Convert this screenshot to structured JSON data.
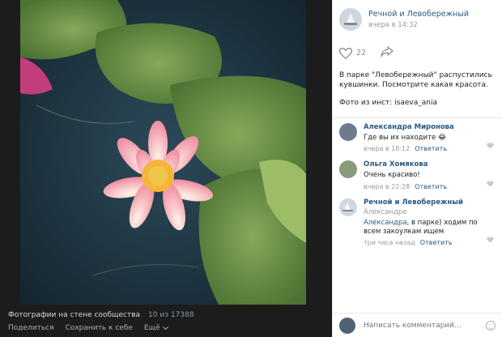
{
  "viewer": {
    "album_title": "Фотографии на стене сообщества",
    "counter": "10 из 17388",
    "share_label": "Поделиться",
    "save_label": "Сохранить к себе",
    "more_label": "Ещё"
  },
  "post": {
    "author": "Речной и Левобережный",
    "time": "вчера в 14:32",
    "likes": "22",
    "text_line1": "В парке \"Левобережный\" распустились",
    "text_line2": "кувшинки. Посмотрите какая красота.",
    "text_line3": "Фото из инст: isaeva_ania"
  },
  "comments": [
    {
      "author": "Александра Миронова",
      "text": "Где вы их находите 😂",
      "time": "вчера в 18:12",
      "reply_label": "Ответить"
    },
    {
      "author": "Ольга Хомякова",
      "text": "Очень красиво!",
      "time": "вчера в 22:28",
      "reply_label": "Ответить"
    },
    {
      "author": "Речной и Левобережный",
      "sub": "Александре",
      "mention": "Александра",
      "text": ", в парке) ходим по всем закоулкам ищем",
      "time": "три часа назад",
      "reply_label": "Ответить"
    }
  ],
  "composer": {
    "placeholder": "Написать комментарий..."
  },
  "icons": {
    "like": "heart-icon",
    "share": "share-arrow-icon",
    "more": "chevron-down-icon",
    "emoji": "smiley-icon"
  },
  "colors": {
    "link": "#2a5885",
    "viewer_bg": "#1c1c1c"
  }
}
